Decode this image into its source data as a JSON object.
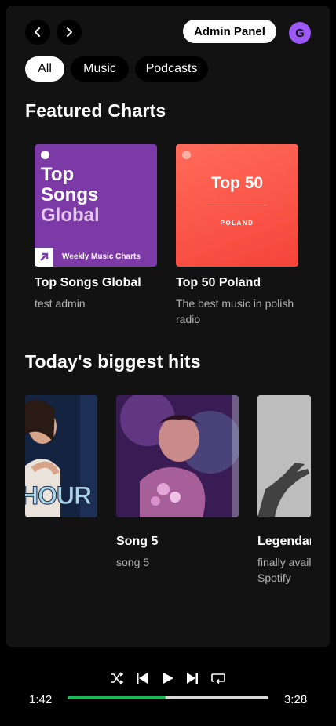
{
  "header": {
    "admin_label": "Admin Panel",
    "avatar_initial": "G"
  },
  "filters": [
    {
      "label": "All",
      "active": true
    },
    {
      "label": "Music",
      "active": false
    },
    {
      "label": "Podcasts",
      "active": false
    }
  ],
  "featured": {
    "title": "Featured Charts",
    "cards": [
      {
        "title": "Top Songs Global",
        "subtitle": "test admin",
        "art": {
          "line1": "Top",
          "line2": "Songs",
          "line3": "Global",
          "footer": "Weekly Music Charts"
        }
      },
      {
        "title": "Top 50 Poland",
        "subtitle": "The best music in polish radio",
        "art": {
          "headline": "Top 50",
          "country": "POLAND"
        }
      }
    ]
  },
  "hits": {
    "title": "Today's biggest hits",
    "cards": [
      {
        "title": "",
        "subtitle": "",
        "art_text": "HOUR"
      },
      {
        "title": "Song 5",
        "subtitle": "song 5"
      },
      {
        "title": "Legendar",
        "subtitle": "finally availa Spotify"
      }
    ]
  },
  "player": {
    "elapsed": "1:42",
    "duration": "3:28",
    "progress_fraction": 0.49
  },
  "colors": {
    "accent": "#1db954",
    "avatar": "#9b59f5",
    "panel": "#121212"
  }
}
